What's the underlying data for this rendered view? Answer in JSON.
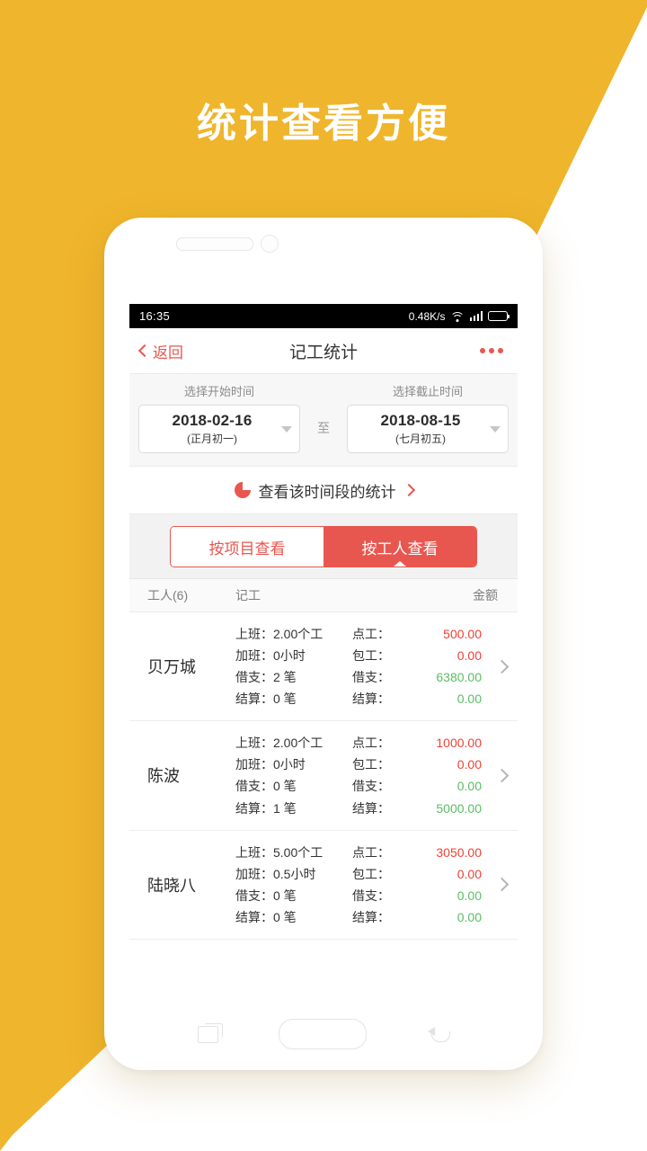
{
  "promo": {
    "headline": "统计查看方便",
    "background_color": "#efb52c"
  },
  "statusbar": {
    "time": "16:35",
    "network_speed": "0.48K/s",
    "wifi_icon": "wifi-icon",
    "signal_icon": "signal-icon",
    "battery_icon": "battery-icon"
  },
  "navbar": {
    "back_label": "返回",
    "title": "记工统计",
    "more_icon": "more-dots-icon",
    "accent_color": "#e8574f"
  },
  "daterange": {
    "start_label": "选择开始时间",
    "start_value": "2018-02-16",
    "start_lunar": "(正月初一)",
    "separator": "至",
    "end_label": "选择截止时间",
    "end_value": "2018-08-15",
    "end_lunar": "(七月初五)"
  },
  "stats_link": {
    "icon": "pie-chart-icon",
    "text": "查看该时间段的统计",
    "chevron": "chevron-right-icon"
  },
  "segmented": {
    "by_project": "按项目查看",
    "by_worker": "按工人查看",
    "active": "按工人查看"
  },
  "table": {
    "headers": {
      "worker": "工人(6)",
      "record": "记工",
      "amount": "金额"
    },
    "rows": [
      {
        "name": "贝万城",
        "records": [
          "上班：2.00个工",
          "加班：0小时",
          "借支：2 笔",
          "结算：0 笔"
        ],
        "amounts": [
          {
            "label": "点工：",
            "value": "500.00",
            "color": "red"
          },
          {
            "label": "包工：",
            "value": "0.00",
            "color": "red"
          },
          {
            "label": "借支：",
            "value": "6380.00",
            "color": "green"
          },
          {
            "label": "结算：",
            "value": "0.00",
            "color": "green"
          }
        ]
      },
      {
        "name": "陈波",
        "records": [
          "上班：2.00个工",
          "加班：0小时",
          "借支：0 笔",
          "结算：1 笔"
        ],
        "amounts": [
          {
            "label": "点工：",
            "value": "1000.00",
            "color": "red"
          },
          {
            "label": "包工：",
            "value": "0.00",
            "color": "red"
          },
          {
            "label": "借支：",
            "value": "0.00",
            "color": "green"
          },
          {
            "label": "结算：",
            "value": "5000.00",
            "color": "green"
          }
        ]
      },
      {
        "name": "陆晓八",
        "records": [
          "上班：5.00个工",
          "加班：0.5小时",
          "借支：0 笔",
          "结算：0 笔"
        ],
        "amounts": [
          {
            "label": "点工：",
            "value": "3050.00",
            "color": "red"
          },
          {
            "label": "包工：",
            "value": "0.00",
            "color": "red"
          },
          {
            "label": "借支：",
            "value": "0.00",
            "color": "green"
          },
          {
            "label": "结算：",
            "value": "0.00",
            "color": "green"
          }
        ]
      }
    ]
  },
  "phone_nav": {
    "recents_icon": "recents-icon",
    "home_icon": "home-icon",
    "back_icon": "back-icon"
  },
  "colors": {
    "accent_red": "#e8574f",
    "amount_red": "#ef4136",
    "amount_green": "#5bbd63",
    "promo_yellow": "#efb52c"
  }
}
